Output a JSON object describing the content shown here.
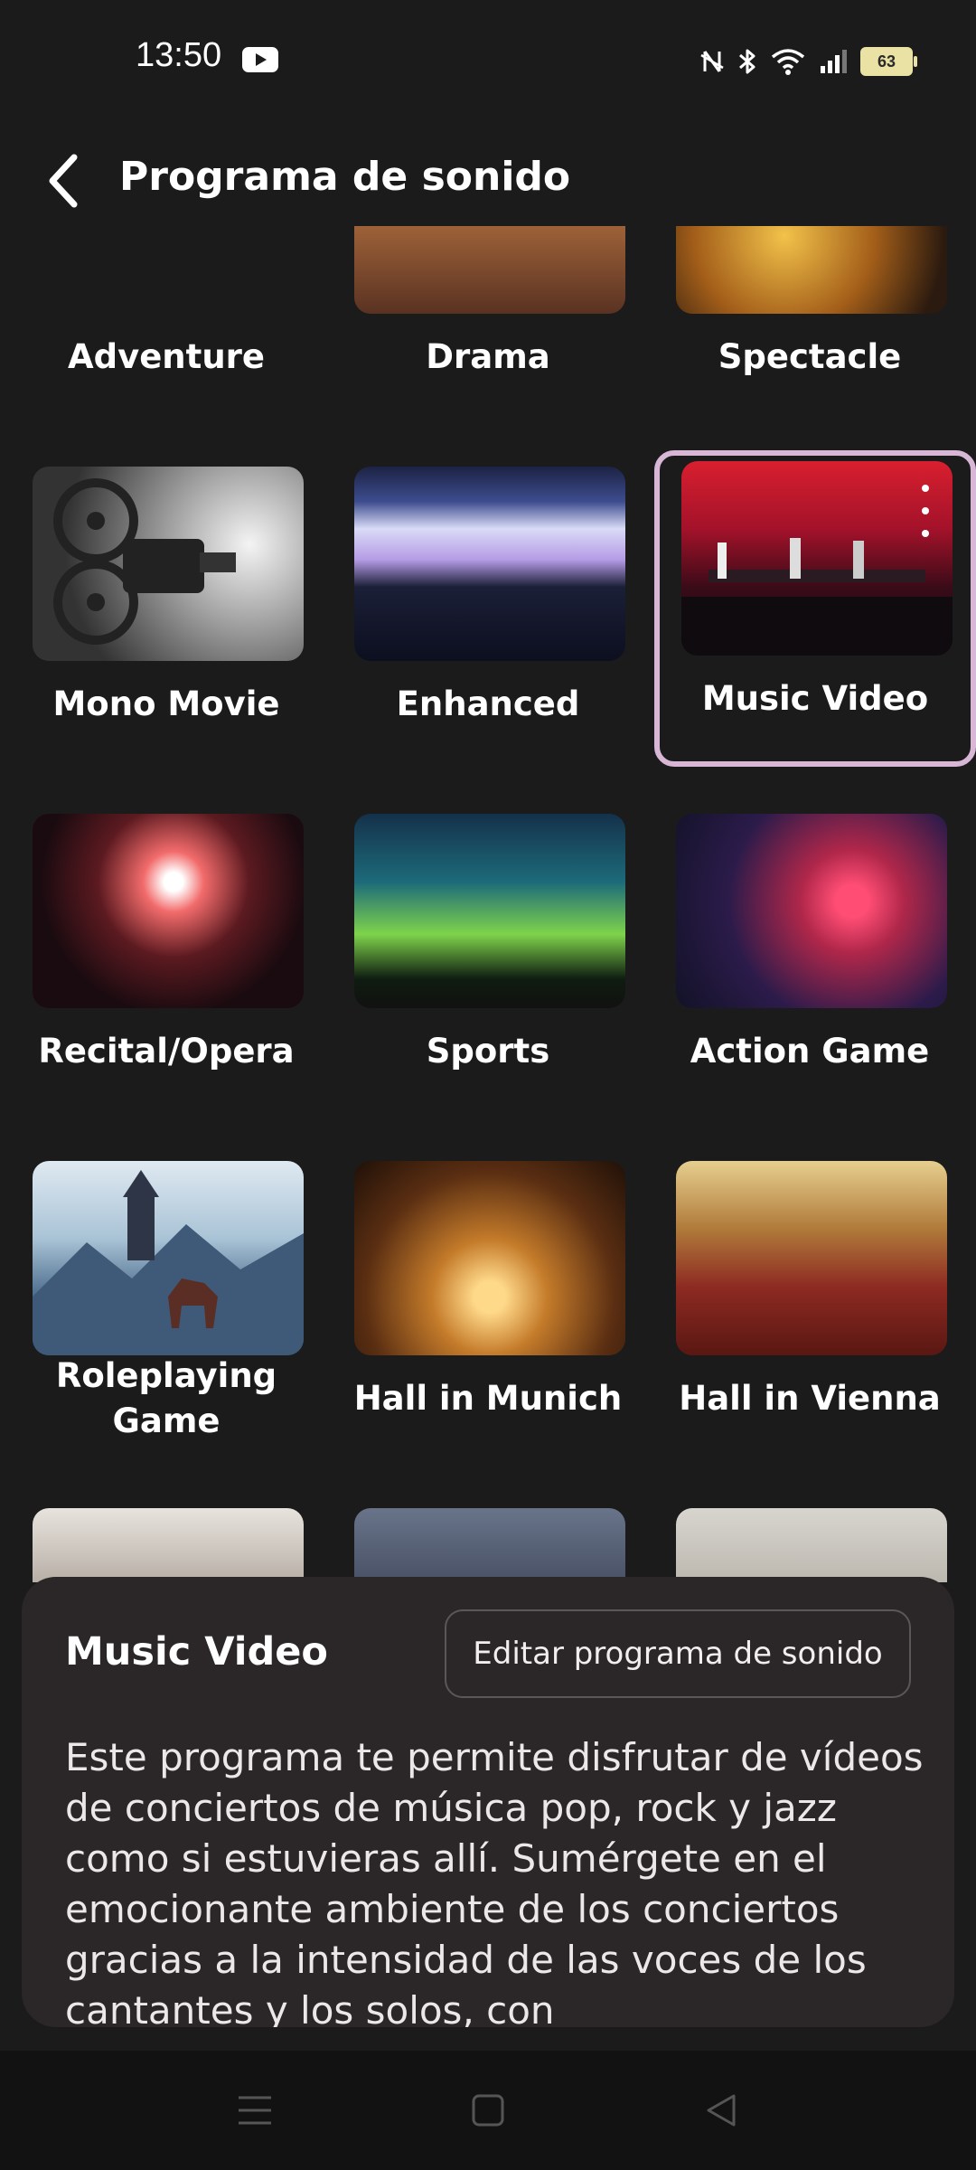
{
  "status_bar": {
    "time": "13:50",
    "battery_level": "63",
    "notification_icons": [
      "youtube-icon"
    ],
    "system_icons": [
      "nfc-icon",
      "bluetooth-icon",
      "wifi-icon",
      "signal-icon",
      "battery-icon"
    ]
  },
  "header": {
    "title": "Programa de sonido",
    "back_icon": "chevron-left-icon"
  },
  "programs": [
    {
      "label": "Adventure"
    },
    {
      "label": "Drama"
    },
    {
      "label": "Spectacle"
    },
    {
      "label": "Mono Movie"
    },
    {
      "label": "Enhanced"
    },
    {
      "label": "Music Video",
      "selected": true
    },
    {
      "label": "Recital/Opera"
    },
    {
      "label": "Sports"
    },
    {
      "label": "Action Game"
    },
    {
      "label": "Roleplaying Game"
    },
    {
      "label": "Hall in Munich"
    },
    {
      "label": "Hall in Vienna"
    },
    {
      "label": ""
    },
    {
      "label": ""
    },
    {
      "label": ""
    }
  ],
  "detail": {
    "title": "Music Video",
    "edit_label": "Editar programa de sonido",
    "description": "Este programa te permite disfrutar de vídeos de conciertos de música pop, rock y jazz como si estuvieras allí. Sumérgete en el emocionante ambiente de los conciertos gracias a la intensidad de las voces de los cantantes y los solos, con"
  },
  "colors": {
    "background": "#1b1b1b",
    "selected_border": "#d8b6d6",
    "sheet_background": "#2b2729"
  },
  "nav_bar": {
    "icons": [
      "menu-icon",
      "home-icon",
      "back-icon"
    ]
  }
}
